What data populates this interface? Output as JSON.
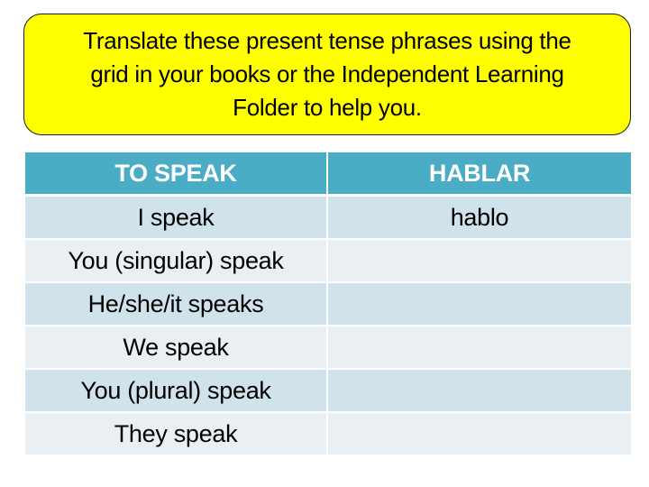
{
  "instruction": {
    "lines": [
      "Translate these present tense phrases using the",
      "grid in your books or the Independent Learning",
      "Folder to help you."
    ],
    "background_color": "#ffff00"
  },
  "table": {
    "header_color": "#4bacc6",
    "headers": [
      "TO SPEAK",
      "HABLAR"
    ],
    "rows": [
      {
        "english": "I speak",
        "spanish": "hablo"
      },
      {
        "english": "You (singular) speak",
        "spanish": ""
      },
      {
        "english": "He/she/it speaks",
        "spanish": ""
      },
      {
        "english": "We speak",
        "spanish": ""
      },
      {
        "english": "You (plural) speak",
        "spanish": ""
      },
      {
        "english": "They speak",
        "spanish": ""
      }
    ]
  }
}
